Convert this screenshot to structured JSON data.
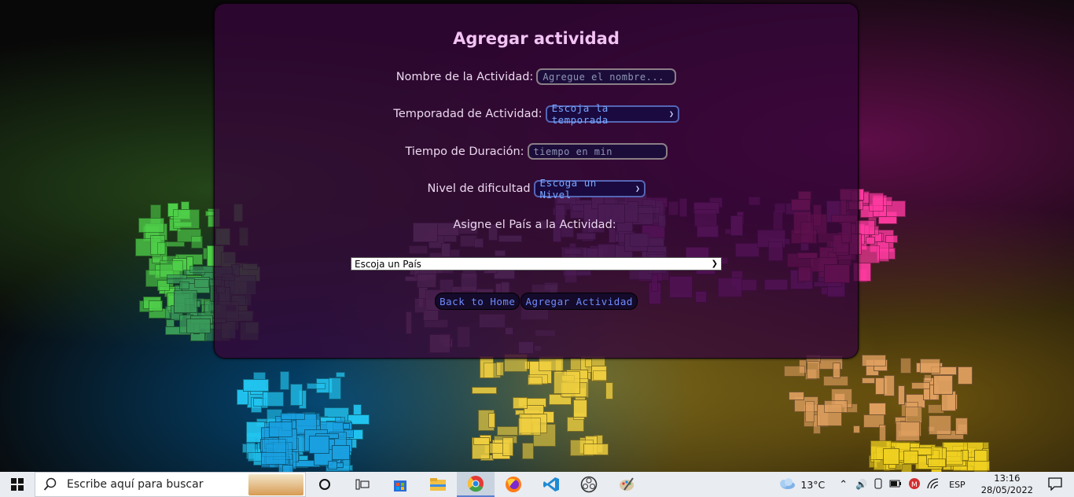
{
  "form": {
    "title": "Agregar actividad",
    "name_label": "Nombre de la Actividad:",
    "name_placeholder": "Agregue el nombre...",
    "season_label": "Temporadad de Actividad:",
    "season_selected": "Escoja la temporada",
    "duration_label": "Tiempo de Duración:",
    "duration_placeholder": "tiempo en min",
    "difficulty_label": "Nivel de dificultad",
    "difficulty_selected": "Escoga un Nivel",
    "country_label": "Asigne el País a la Actividad:",
    "country_selected": "Escoja un País",
    "back_button": "Back to Home",
    "submit_button": "Agregar Actividad"
  },
  "taskbar": {
    "search_placeholder": "Escribe aquí para buscar",
    "weather": "13°C",
    "language": "ESP",
    "time": "13:16",
    "date": "28/05/2022"
  },
  "colors": {
    "panel": "#34063a",
    "title": "#f1c2f3",
    "select_text": "#7aa7ff",
    "button_text": "#6f8cff"
  }
}
